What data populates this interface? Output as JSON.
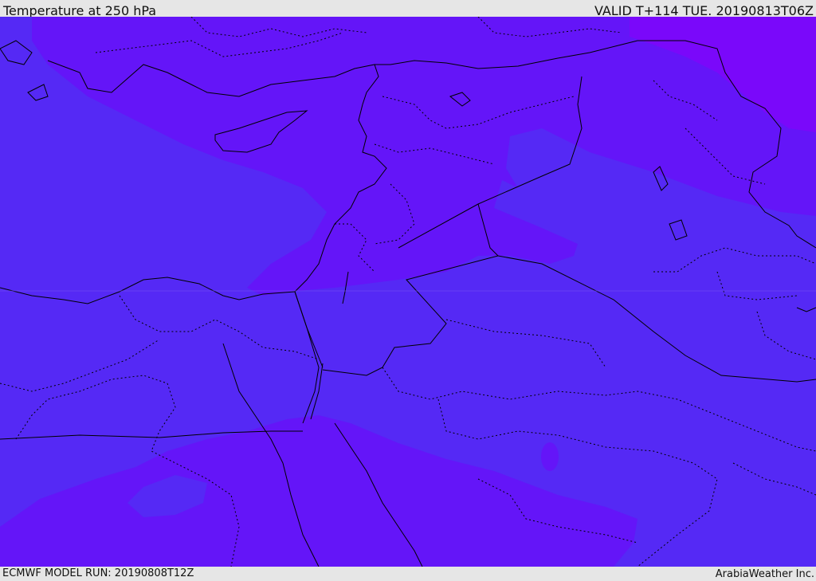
{
  "header": {
    "title": "Temperature at 250 hPa",
    "valid": "VALID T+114 TUE. 20190813T06Z"
  },
  "footer": {
    "model_run": "ECMWF MODEL RUN: 20190808T12Z",
    "credit": "ArabiaWeather Inc."
  },
  "map": {
    "colors": {
      "shade_base": "#5529f5",
      "shade_mid": "#6415f8",
      "shade_warm": "#7a08fa",
      "border_line": "#000000"
    },
    "icons": [
      "coastline-lines",
      "country-border-lines",
      "province-border-lines"
    ]
  }
}
